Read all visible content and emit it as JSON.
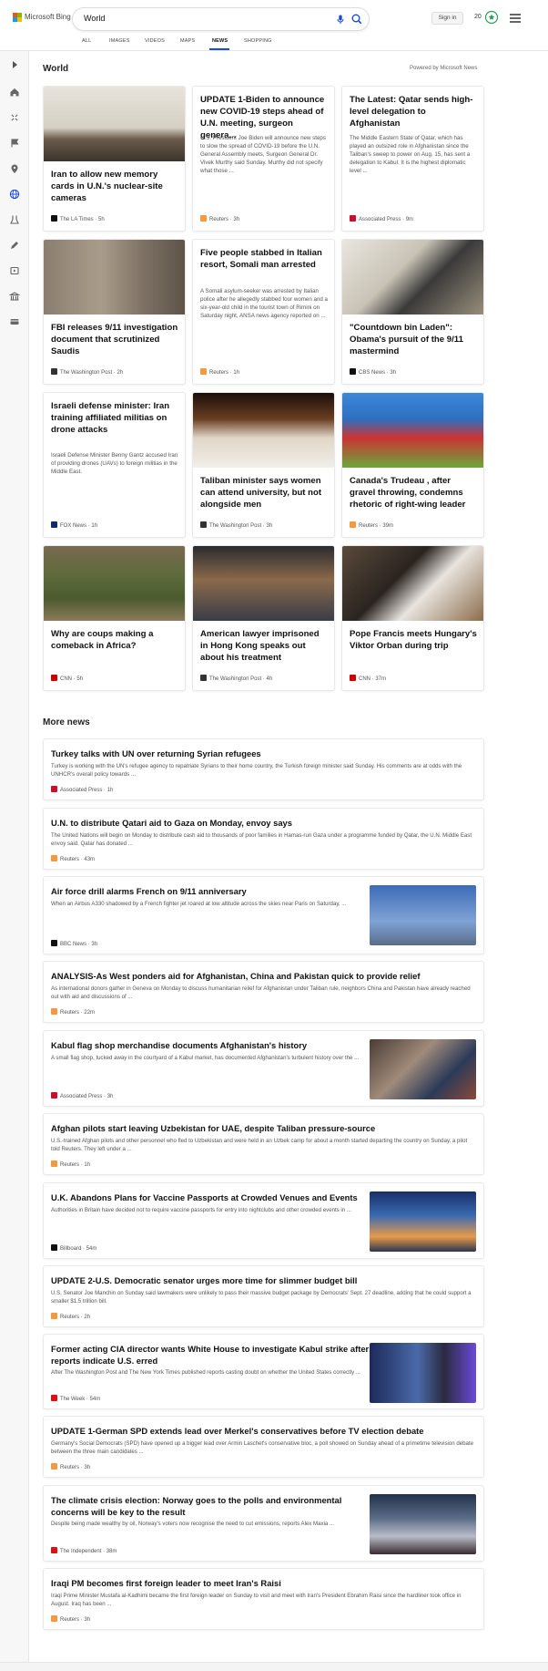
{
  "header": {
    "brand": "Microsoft Bing",
    "query": "World",
    "sign_in": "Sign in",
    "points": "20"
  },
  "tabs": [
    "ALL",
    "IMAGES",
    "VIDEOS",
    "MAPS",
    "NEWS",
    "SHOPPING"
  ],
  "active_tab": "NEWS",
  "rail_icons": [
    "expand-icon",
    "home-icon",
    "recommended-icon",
    "flag-icon",
    "location-icon",
    "globe-icon",
    "science-icon",
    "technology-icon",
    "entertainment-icon",
    "money-icon",
    "card-icon"
  ],
  "world": {
    "heading": "World",
    "powered": "Powered by Microsoft News"
  },
  "cards": [
    {
      "title": "Iran to allow new memory cards in U.N.'s nuclear-site cameras",
      "snippet": "",
      "source": "The LA Times",
      "time": "5h",
      "src_color": "#111"
    },
    {
      "title": "UPDATE 1-Biden to announce new COVID-19 steps ahead of U.N. meeting, surgeon genera...",
      "snippet": "U.S. President Joe Biden will announce new steps to slow the spread of COVID-19 before the U.N. General Assembly meets, Surgeon General Dr. Vivek Murthy said Sunday. Murthy did not specify what those ...",
      "source": "Reuters",
      "time": "3h",
      "src_color": "#f29a3d"
    },
    {
      "title": "The Latest: Qatar sends high-level delegation to Afghanistan",
      "snippet": "The Middle Eastern State of Qatar, which has played an outsized role in Afghanistan since the Taliban's sweep to power on Aug. 15, has sent a delegation to Kabul. It is the highest diplomatic level ...",
      "source": "Associated Press",
      "time": "9m",
      "src_color": "#c8102e"
    },
    {
      "title": "FBI releases 9/11 investigation document that scrutinized Saudis",
      "snippet": "",
      "source": "The Washington Post",
      "time": "2h",
      "src_color": "#333"
    },
    {
      "title": "Five people stabbed in Italian resort, Somali man arrested",
      "snippet": "A Somali asylum-seeker was arrested by Italian police after he allegedly stabbed four women and a six-year-old child in the tourist town of Rimini on Saturday night, ANSA news agency reported on ...",
      "source": "Reuters",
      "time": "1h",
      "src_color": "#f29a3d"
    },
    {
      "title": "\"Countdown bin Laden\": Obama's pursuit of the 9/11 mastermind",
      "snippet": "",
      "source": "CBS News",
      "time": "3h",
      "src_color": "#111"
    },
    {
      "title": "Israeli defense minister: Iran training affiliated militias on drone attacks",
      "snippet": "Israeli Defense Minister Benny Gantz accused Iran of providing drones (UAVs) to foreign militias in the Middle East.",
      "source": "FOX News",
      "time": "1h",
      "src_color": "#0f2a6b"
    },
    {
      "title": "Taliban minister says women can attend university, but not alongside men",
      "snippet": "",
      "source": "The Washington Post",
      "time": "3h",
      "src_color": "#333"
    },
    {
      "title": "Canada's Trudeau , after gravel throwing, condemns rhetoric of right-wing leader",
      "snippet": "",
      "source": "Reuters",
      "time": "39m",
      "src_color": "#f29a3d"
    },
    {
      "title": "Why are coups making a comeback in Africa?",
      "snippet": "",
      "source": "CNN",
      "time": "5h",
      "src_color": "#cc0000"
    },
    {
      "title": "American lawyer imprisoned in Hong Kong speaks out about his treatment",
      "snippet": "",
      "source": "The Washington Post",
      "time": "4h",
      "src_color": "#333"
    },
    {
      "title": "Pope Francis meets Hungary's Viktor Orban during trip",
      "snippet": "",
      "source": "CNN",
      "time": "37m",
      "src_color": "#cc0000"
    }
  ],
  "more_news": {
    "heading": "More news",
    "items": [
      {
        "title": "Turkey talks with UN over returning Syrian refugees",
        "snippet": "Turkey is working with the UN's refugee agency to repatriate Syrians to their home country, the Turkish foreign minister said Sunday. His comments are at odds with the UNHCR's overall policy towards ...",
        "source": "Associated Press",
        "time": "1h",
        "src_color": "#c8102e"
      },
      {
        "title": "U.N. to distribute Qatari aid to Gaza on Monday, envoy says",
        "snippet": "The United Nations will begin on Monday to distribute cash aid to thousands of poor families in Hamas-run Gaza under a programme funded by Qatar, the U.N. Middle East envoy said. Qatar has donated ...",
        "source": "Reuters",
        "time": "43m",
        "src_color": "#f29a3d"
      },
      {
        "title": "Air force drill alarms French on 9/11 anniversary",
        "snippet": "When an Airbus A330 shadowed by a French fighter jet roared at low altitude across the skies near Paris on Saturday, ...",
        "source": "BBC News",
        "time": "3h",
        "src_color": "#111"
      },
      {
        "title": "ANALYSIS-As West ponders aid for Afghanistan, China and Pakistan quick to provide relief",
        "snippet": "As international donors gather in Geneva on Monday to discuss humanitarian relief for Afghanistan under Taliban rule, neighbors China and Pakistan have already reached out with aid and discussions of ...",
        "source": "Reuters",
        "time": "22m",
        "src_color": "#f29a3d"
      },
      {
        "title": "Kabul flag shop merchandise documents Afghanistan's history",
        "snippet": "A small flag shop, tucked away in the courtyard of a Kabul market, has documented Afghanistan's turbulent history over the ...",
        "source": "Associated Press",
        "time": "3h",
        "src_color": "#c8102e"
      },
      {
        "title": "Afghan pilots start leaving Uzbekistan for UAE, despite Taliban pressure-source",
        "snippet": "U.S.-trained Afghan pilots and other personnel who fled to Uzbekistan and were held in an Uzbek camp for about a month started departing the country on Sunday, a pilot told Reuters. They left under a ...",
        "source": "Reuters",
        "time": "1h",
        "src_color": "#f29a3d"
      },
      {
        "title": "U.K. Abandons Plans for Vaccine Passports at Crowded Venues and Events",
        "snippet": "Authorities in Britain have decided not to require vaccine passports for entry into nightclubs and other crowded events in ...",
        "source": "Billboard",
        "time": "54m",
        "src_color": "#111"
      },
      {
        "title": "UPDATE 2-U.S. Democratic senator urges more time for slimmer budget bill",
        "snippet": "U.S. Senator Joe Manchin on Sunday said lawmakers were unlikely to pass their massive budget package by Democrats' Sept. 27 deadline, adding that he could support a smaller $1.5 trillion bill.",
        "source": "Reuters",
        "time": "2h",
        "src_color": "#f29a3d"
      },
      {
        "title": "Former acting CIA director wants White House to investigate Kabul strike after reports indicate U.S. erred",
        "snippet": "After The Washington Post and The New York Times published reports casting doubt on whether the United States correctly ...",
        "source": "The Week",
        "time": "54m",
        "src_color": "#d11"
      },
      {
        "title": "UPDATE 1-German SPD extends lead over Merkel's conservatives before TV election debate",
        "snippet": "Germany's Social Democrats (SPD) have opened up a bigger lead over Armin Laschet's conservative bloc, a poll showed on Sunday ahead of a primetime television debate between the three main candidates ...",
        "source": "Reuters",
        "time": "3h",
        "src_color": "#f29a3d"
      },
      {
        "title": "The climate crisis election: Norway goes to the polls and environmental concerns will be key to the result",
        "snippet": "Despite being made wealthy by oil, Norway's voters now recognise the need to cut emissions, reports Alex Maxia ...",
        "source": "The Independent",
        "time": "38m",
        "src_color": "#d11"
      },
      {
        "title": "Iraqi PM becomes first foreign leader to meet Iran's Raisi",
        "snippet": "Iraqi Prime Minister Mustafa al-Kadhimi became the first foreign leader on Sunday to visit and meet with Iran's President Ebrahim Raisi since the hardliner took office in August. Iraq has been ...",
        "source": "Reuters",
        "time": "3h",
        "src_color": "#f29a3d"
      }
    ]
  },
  "colors": {
    "accent": "#174ae4",
    "rail_bg": "#f7f7f7"
  }
}
